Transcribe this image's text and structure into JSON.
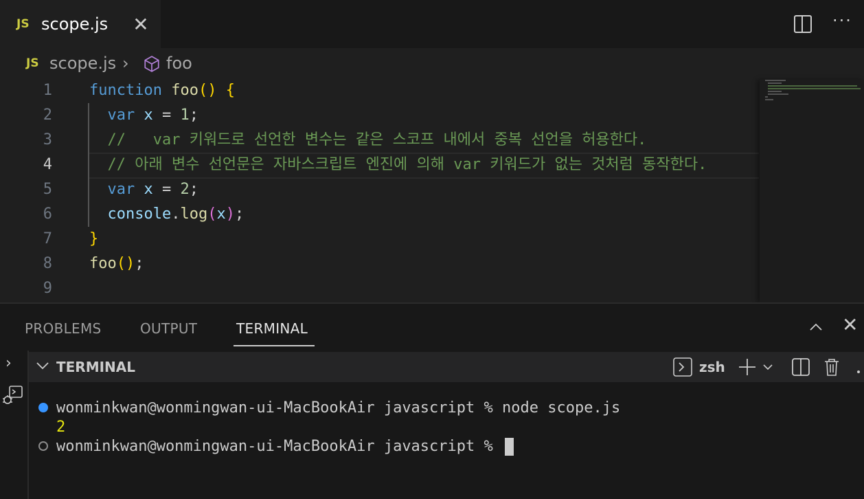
{
  "tab": {
    "badge": "JS",
    "label": "scope.js",
    "close_glyph": "✕"
  },
  "top_actions": {
    "split_icon": "split-editor-icon",
    "more_glyph": "···"
  },
  "breadcrumb": {
    "badge": "JS",
    "file": "scope.js",
    "sep": "›",
    "symbol": "foo"
  },
  "editor": {
    "active_line": 4,
    "line_numbers": [
      "1",
      "2",
      "3",
      "4",
      "5",
      "6",
      "7",
      "8",
      "9"
    ],
    "lines": [
      [
        {
          "t": "function",
          "c": "kw"
        },
        {
          "t": " "
        },
        {
          "t": "foo",
          "c": "fn"
        },
        {
          "t": "()",
          "c": "br1"
        },
        {
          "t": " "
        },
        {
          "t": "{",
          "c": "br1"
        }
      ],
      [
        {
          "t": "  "
        },
        {
          "t": "var",
          "c": "kw"
        },
        {
          "t": " "
        },
        {
          "t": "x",
          "c": "var"
        },
        {
          "t": " = "
        },
        {
          "t": "1",
          "c": "num"
        },
        {
          "t": ";"
        }
      ],
      [
        {
          "t": "  "
        },
        {
          "t": "//   var 키워드로 선언한 변수는 같은 스코프 내에서 중복 선언을 허용한다.",
          "c": "cmt"
        }
      ],
      [
        {
          "t": "  "
        },
        {
          "t": "// 아래 변수 선언문은 자바스크립트 엔진에 의해 var 키워드가 없는 것처럼 동작한다.",
          "c": "cmt"
        }
      ],
      [
        {
          "t": "  "
        },
        {
          "t": "var",
          "c": "kw"
        },
        {
          "t": " "
        },
        {
          "t": "x",
          "c": "var"
        },
        {
          "t": " = "
        },
        {
          "t": "2",
          "c": "num"
        },
        {
          "t": ";"
        }
      ],
      [
        {
          "t": "  "
        },
        {
          "t": "console",
          "c": "var"
        },
        {
          "t": "."
        },
        {
          "t": "log",
          "c": "fn"
        },
        {
          "t": "(",
          "c": "br2"
        },
        {
          "t": "x",
          "c": "var"
        },
        {
          "t": ")",
          "c": "br2"
        },
        {
          "t": ";"
        }
      ],
      [
        {
          "t": "}",
          "c": "br1"
        }
      ],
      [
        {
          "t": "foo",
          "c": "fn"
        },
        {
          "t": "()",
          "c": "br1"
        },
        {
          "t": ";"
        }
      ],
      []
    ]
  },
  "panel": {
    "tabs": [
      "PROBLEMS",
      "OUTPUT",
      "TERMINAL"
    ],
    "active_tab": "TERMINAL",
    "terminal_title": "TERMINAL",
    "shell": "zsh"
  },
  "terminal": {
    "line1": "wonminkwan@wonmingwan-ui-MacBookAir javascript % node scope.js",
    "output": "2",
    "prompt": "wonminkwan@wonmingwan-ui-MacBookAir javascript % "
  },
  "colors": {
    "accent_dot": "#3794ff",
    "output": "#e5e510",
    "js_badge": "#cbcb41"
  }
}
